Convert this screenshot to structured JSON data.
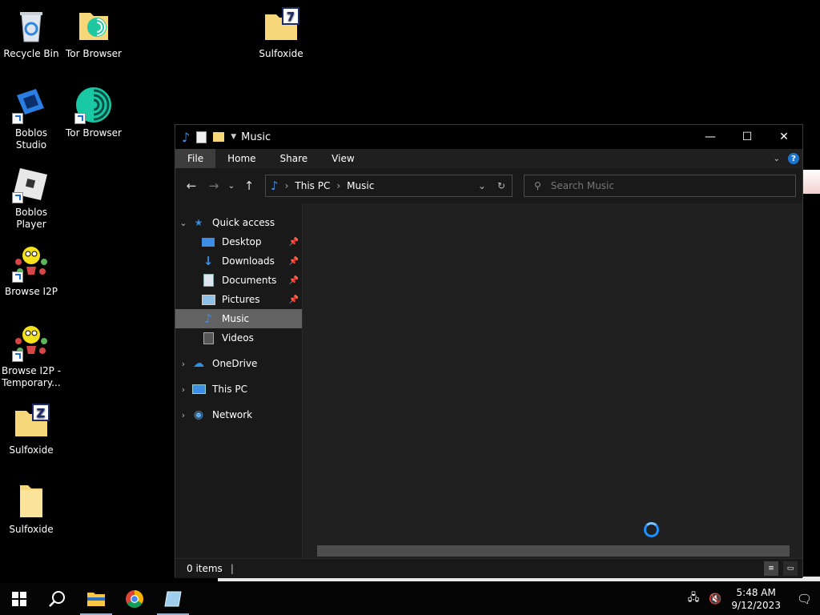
{
  "desktop": {
    "icons": [
      {
        "label": "Recycle Bin",
        "icon": "recycle-bin-icon"
      },
      {
        "label": "Tor Browser",
        "icon": "tor-browser-folder-icon"
      },
      {
        "label": "Sulfoxide",
        "icon": "sulfoxide-folder-icon"
      },
      {
        "label": "Boblos Studio",
        "icon": "boblos-studio-icon"
      },
      {
        "label": "Tor Browser",
        "icon": "tor-browser-icon"
      },
      {
        "label": "Boblos Player",
        "icon": "boblos-player-icon"
      },
      {
        "label": "Browse I2P",
        "icon": "i2p-icon"
      },
      {
        "label": "Browse I2P - Temporary...",
        "icon": "i2p-icon"
      },
      {
        "label": "Sulfoxide",
        "icon": "sulfoxide-folder-icon"
      },
      {
        "label": "Sulfoxide",
        "icon": "folder-icon"
      }
    ]
  },
  "explorer": {
    "title": "Music",
    "ribbon_tabs": [
      "File",
      "Home",
      "Share",
      "View"
    ],
    "address": {
      "segments": [
        "This PC",
        "Music"
      ]
    },
    "search": {
      "placeholder": "Search Music"
    },
    "nav": {
      "quick_access": "Quick access",
      "items": [
        {
          "label": "Desktop",
          "pinned": true
        },
        {
          "label": "Downloads",
          "pinned": true
        },
        {
          "label": "Documents",
          "pinned": true
        },
        {
          "label": "Pictures",
          "pinned": true
        },
        {
          "label": "Music",
          "selected": true
        },
        {
          "label": "Videos"
        }
      ],
      "roots": [
        "OneDrive",
        "This PC",
        "Network"
      ]
    },
    "status": {
      "items": "0 items"
    }
  },
  "taskbar": {
    "time": "5:48 AM",
    "date": "9/12/2023"
  },
  "colors": {
    "accent": "#1a75d1",
    "selected": "#626262",
    "background": "#000000"
  }
}
